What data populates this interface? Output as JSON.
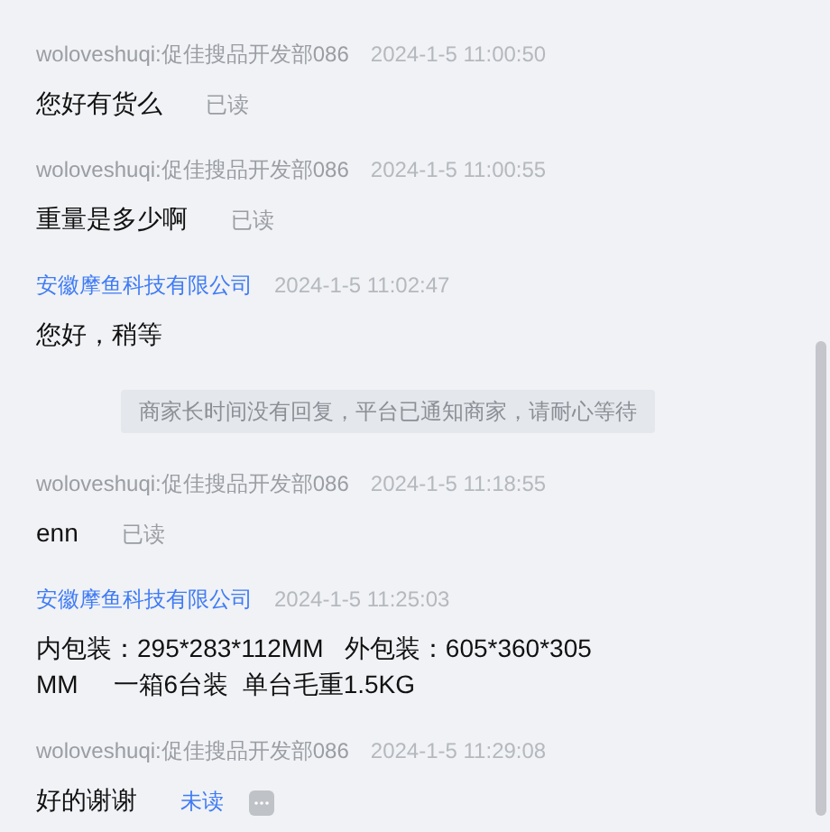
{
  "messages": [
    {
      "kind": "message",
      "merchant": false,
      "sender": "woloveshuqi:促佳搜品开发部086",
      "time": "2024-1-5 11:00:50",
      "text": "您好有货么",
      "status": {
        "text": "已读",
        "read": true
      }
    },
    {
      "kind": "message",
      "merchant": false,
      "sender": "woloveshuqi:促佳搜品开发部086",
      "time": "2024-1-5 11:00:55",
      "text": "重量是多少啊",
      "status": {
        "text": "已读",
        "read": true
      }
    },
    {
      "kind": "message",
      "merchant": true,
      "sender": "安徽摩鱼科技有限公司",
      "time": "2024-1-5 11:02:47",
      "text": "您好，稍等"
    },
    {
      "kind": "notice",
      "text": "商家长时间没有回复，平台已通知商家，请耐心等待"
    },
    {
      "kind": "message",
      "merchant": false,
      "sender": "woloveshuqi:促佳搜品开发部086",
      "time": "2024-1-5 11:18:55",
      "text": "enn",
      "status": {
        "text": "已读",
        "read": true
      }
    },
    {
      "kind": "message",
      "merchant": true,
      "sender": "安徽摩鱼科技有限公司",
      "time": "2024-1-5 11:25:03",
      "text": "内包装：295*283*112MM   外包装：605*360*305 MM     一箱6台装  单台毛重1.5KG"
    },
    {
      "kind": "message",
      "merchant": false,
      "sender": "woloveshuqi:促佳搜品开发部086",
      "time": "2024-1-5 11:29:08",
      "text": "好的谢谢",
      "status": {
        "text": "未读",
        "read": false
      },
      "more_button": true
    }
  ]
}
